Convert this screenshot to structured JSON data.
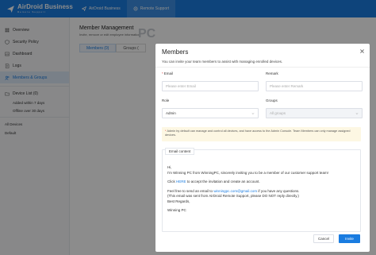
{
  "topbar": {
    "brand_title": "AirDroid Business",
    "brand_sub": "Remote Support",
    "nav": [
      {
        "label": "AirDroid Business",
        "icon": "send-icon"
      },
      {
        "label": "Remote Support",
        "icon": "remote-icon"
      }
    ]
  },
  "sidebar": {
    "items": [
      {
        "label": "Overview",
        "icon": "grid-icon"
      },
      {
        "label": "Security Policy",
        "icon": "shield-icon"
      },
      {
        "label": "Dashboard",
        "icon": "dashboard-icon"
      },
      {
        "label": "Logs",
        "icon": "document-icon"
      },
      {
        "label": "Members & Groups",
        "icon": "members-icon"
      },
      {
        "label": "Device List (0)",
        "icon": "folder-icon"
      }
    ],
    "device_filters": [
      "Added within 7 days",
      "Offline over 30 days"
    ],
    "groups_header": "All Devices",
    "groups": [
      "Default"
    ]
  },
  "main": {
    "title": "Member Management",
    "desc": "Invite, remove or edit employee information",
    "tabs": [
      "Members (0)",
      "Groups ("
    ],
    "watermark": "PC"
  },
  "modal": {
    "title": "Members",
    "desc": "You can invite your team members to assist with managing enrolled devices.",
    "email_label": "Email",
    "email_placeholder": "Please enter Email",
    "remark_label": "Remark",
    "remark_placeholder": "Please enter Remark",
    "role_label": "Role",
    "role_value": "Admin",
    "groups_label": "Groups",
    "groups_value": "All groups",
    "notice": "Admin by default can manage and control all devices, and have access to the Admin Console. Team Members can only manage assigned devices.",
    "email_content_tab": "Email content",
    "email": {
      "greeting": "Hi,",
      "line1": "I'm Winning PC from WinningPC,  sincerely inviting you to be a member of our customer support team!",
      "click": "Click",
      "here": "HERE",
      "click_rest": "to accept the invitation and create an account.",
      "feel_free": "Feel free to send an email to",
      "email_address": "winningpc.com@gmail.com",
      "feel_free_rest": "if you have any questions.",
      "note": "(This email was sent from AirDroid Remote Support, please DO NOT reply directly.)",
      "regards": "Best Regards,",
      "signature": "Winning PC"
    },
    "cancel_label": "Cancel",
    "invite_label": "Invite"
  },
  "colors": {
    "primary": "#1a7ce0",
    "notice_bg": "#fdf7e3",
    "required": "#e54545"
  }
}
